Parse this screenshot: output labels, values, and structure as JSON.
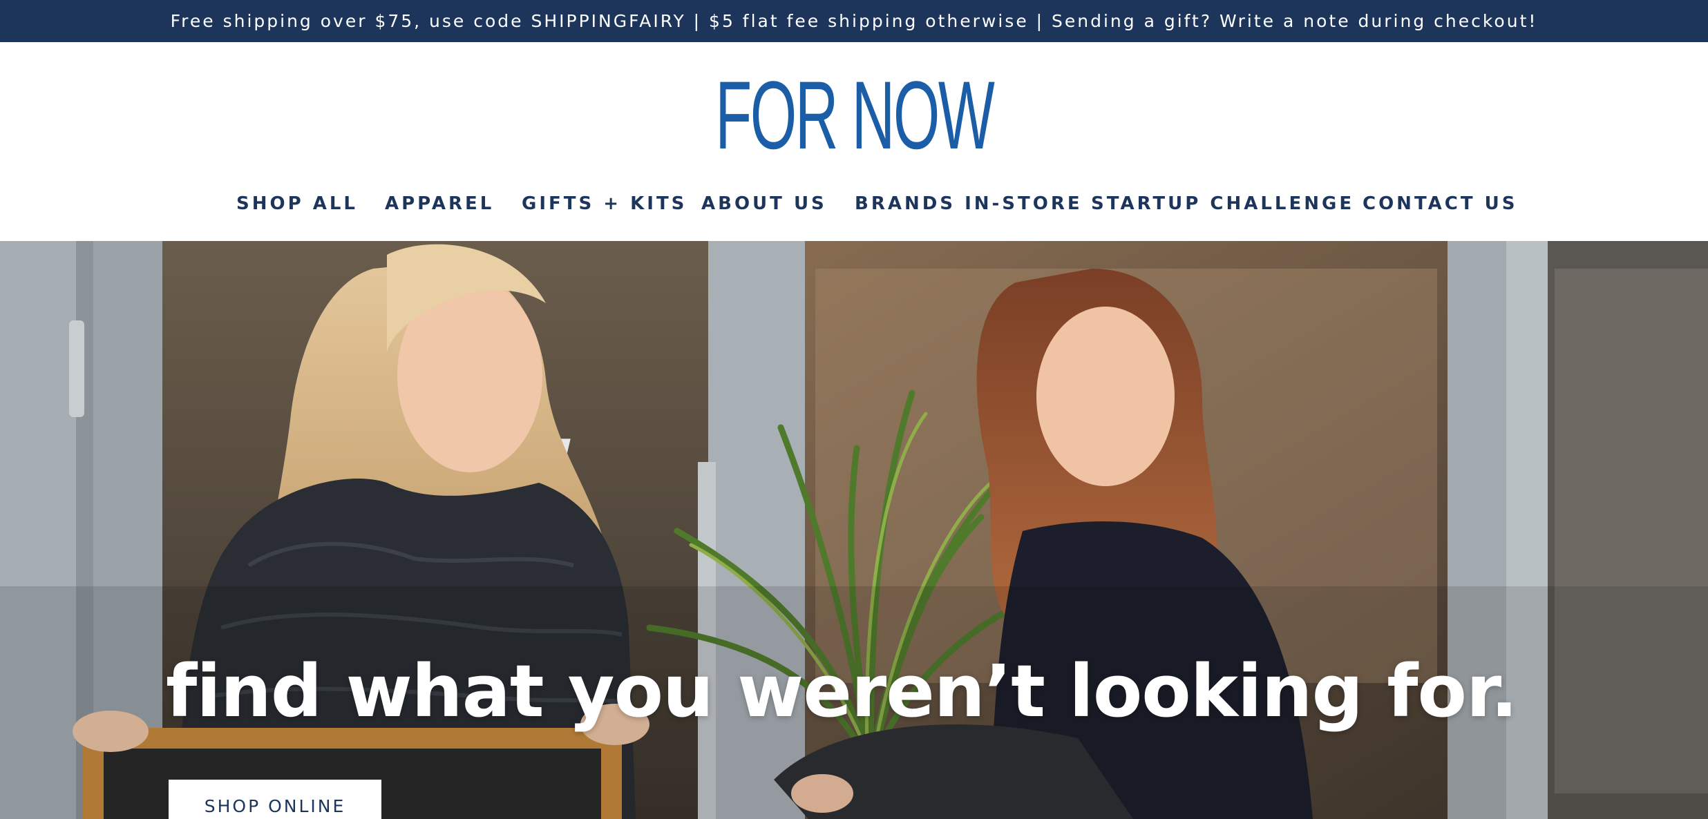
{
  "announcement": {
    "text": "Free shipping over $75, use code SHIPPINGFAIRY | $5 flat fee shipping otherwise | Sending a gift? Write a note during checkout!"
  },
  "header": {
    "logo": "FOR NOW"
  },
  "nav": {
    "items": [
      {
        "label": "SHOP ALL"
      },
      {
        "label": "APPAREL"
      },
      {
        "label": "GIFTS + KITS"
      },
      {
        "label": "ABOUT US"
      },
      {
        "label": "BRANDS IN-STORE"
      },
      {
        "label": "STARTUP CHALLENGE"
      },
      {
        "label": "CONTACT US"
      }
    ]
  },
  "hero": {
    "tagline": "find what you weren’t looking for.",
    "cta_label": "SHOP ONLINE"
  },
  "colors": {
    "announcement_bg": "#1d355b",
    "logo": "#1b5ea7",
    "nav_text": "#1d355b",
    "hero_text": "#ffffff"
  }
}
